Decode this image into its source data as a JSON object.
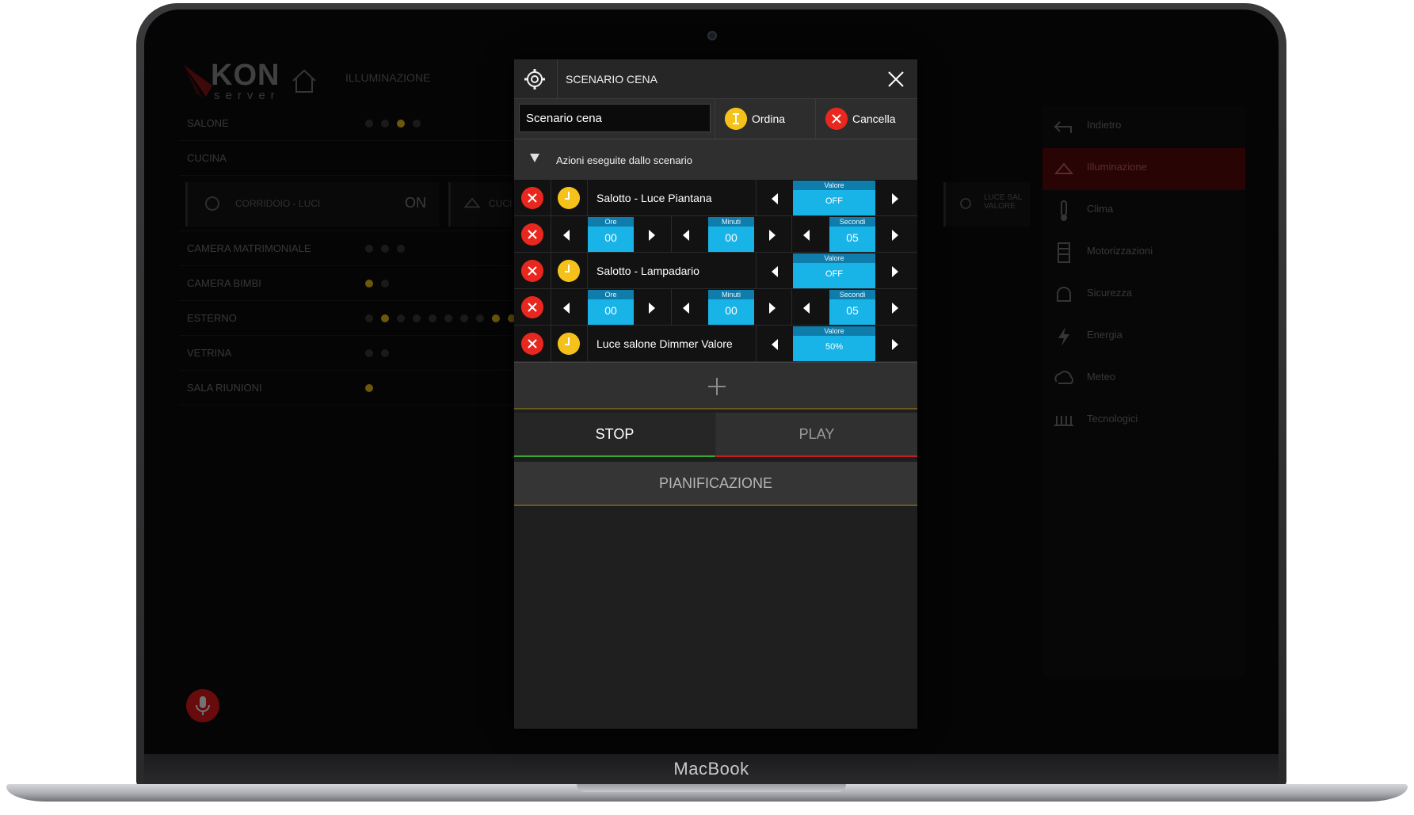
{
  "laptop": {
    "brand": "MacBook"
  },
  "background_app": {
    "logo_text": "KON",
    "logo_sub": "server",
    "breadcrumb": "ILLUMINAZIONE",
    "rooms": [
      {
        "name": "SALONE"
      },
      {
        "name": "CUCINA"
      },
      {
        "name": "CAMERA MATRIMONIALE"
      },
      {
        "name": "CAMERA BIMBI"
      },
      {
        "name": "ESTERNO"
      },
      {
        "name": "VETRINA"
      },
      {
        "name": "SALA RIUNIONI"
      }
    ],
    "tiles": {
      "t1_label": "CORRIDOIO - LUCI",
      "t1_state": "ON",
      "t2_label": "CUCI",
      "t3_label": "LUCE SAL VALORE"
    },
    "side_menu": [
      {
        "label": "Indietro",
        "icon": "back-icon"
      },
      {
        "label": "Illuminazione",
        "icon": "lamp-icon",
        "active": true
      },
      {
        "label": "Clima",
        "icon": "thermometer-icon"
      },
      {
        "label": "Motorizzazioni",
        "icon": "shutter-icon"
      },
      {
        "label": "Sicurezza",
        "icon": "bell-icon"
      },
      {
        "label": "Energia",
        "icon": "bolt-icon"
      },
      {
        "label": "Meteo",
        "icon": "cloud-icon"
      },
      {
        "label": "Tecnologici",
        "icon": "heater-icon"
      }
    ]
  },
  "modal": {
    "title": "SCENARIO CENA",
    "name_value": "Scenario cena",
    "order_label": "Ordina",
    "cancel_label": "Cancella",
    "section_label": "Azioni eseguite dallo scenario",
    "actions": [
      {
        "device": "Salotto - Luce Piantana",
        "value_caption": "Valore",
        "value": "OFF"
      },
      {
        "delay": {
          "ore_caption": "Ore",
          "ore": "00",
          "min_caption": "Minuti",
          "min": "00",
          "sec_caption": "Secondi",
          "sec": "05"
        }
      },
      {
        "device": "Salotto - Lampadario",
        "value_caption": "Valore",
        "value": "OFF"
      },
      {
        "delay": {
          "ore_caption": "Ore",
          "ore": "00",
          "min_caption": "Minuti",
          "min": "00",
          "sec_caption": "Secondi",
          "sec": "05"
        }
      },
      {
        "device": "Luce salone Dimmer Valore",
        "value_caption": "Valore",
        "value": "50%"
      }
    ],
    "tab_stop": "STOP",
    "tab_play": "PLAY",
    "planning_label": "PIANIFICAZIONE"
  },
  "colors": {
    "accent_cyan": "#18b4e8",
    "delete_red": "#e8271f",
    "clock_yellow": "#f4c21a",
    "stop_green": "#37a832",
    "play_red": "#c22020"
  }
}
